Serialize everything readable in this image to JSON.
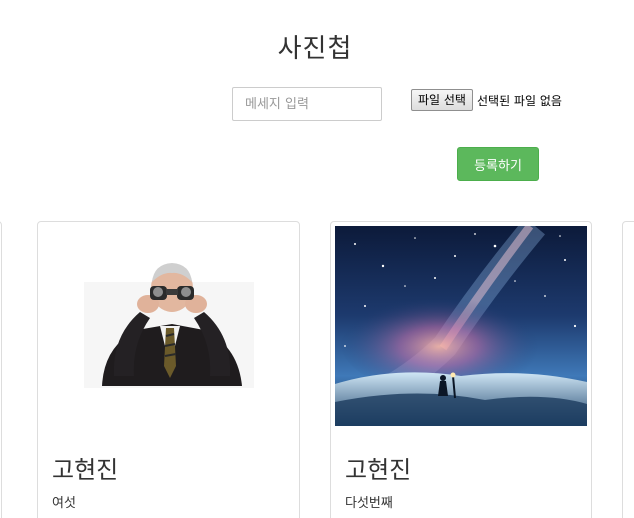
{
  "header": {
    "title": "사진첩"
  },
  "form": {
    "message_placeholder": "메세지 입력",
    "file_button_label": "파일 선택",
    "file_status": "선택된 파일 없음",
    "register_label": "등록하기"
  },
  "colors": {
    "register_button": "#5cb85c",
    "card_border": "#dddddd"
  },
  "cards": [
    {
      "name": "고현진",
      "description": "여섯",
      "image": "man-with-binoculars-photo"
    },
    {
      "name": "고현진",
      "description": "다섯번째",
      "image": "night-sky-galaxy-illustration"
    }
  ]
}
